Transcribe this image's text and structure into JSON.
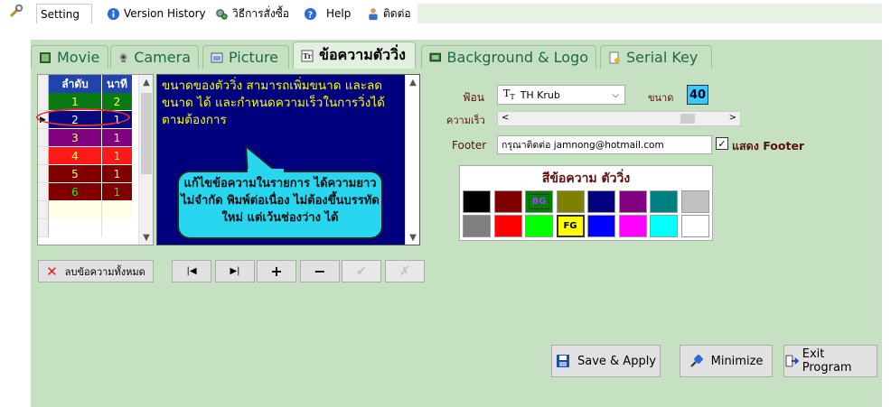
{
  "menu": {
    "items": [
      {
        "label": "Setting"
      },
      {
        "label": "Version History"
      },
      {
        "label": "วิธีการสั่งซื้อ"
      },
      {
        "label": "Help"
      },
      {
        "label": "ติดต่อ"
      }
    ]
  },
  "tabs": [
    {
      "label": "Movie"
    },
    {
      "label": "Camera"
    },
    {
      "label": "Picture"
    },
    {
      "label": "ข้อความตัววิ่ง"
    },
    {
      "label": "Background & Logo"
    },
    {
      "label": "Serial Key"
    }
  ],
  "grid": {
    "headers": [
      "ลำดับ",
      "นาที"
    ],
    "rows": [
      {
        "order": "1",
        "minutes": "2",
        "bg": "#0a7a12",
        "fg": "#ffff66"
      },
      {
        "order": "2",
        "minutes": "1",
        "bg": "#0a0a80",
        "fg": "#ffffff"
      },
      {
        "order": "3",
        "minutes": "1",
        "bg": "#800080",
        "fg": "#ffff66"
      },
      {
        "order": "4",
        "minutes": "1",
        "bg": "#ff1a1a",
        "fg": "#ffff66"
      },
      {
        "order": "5",
        "minutes": "1",
        "bg": "#800000",
        "fg": "#ffff66"
      },
      {
        "order": "6",
        "minutes": "1",
        "bg": "#800000",
        "fg": "#00ff00"
      }
    ]
  },
  "text_area": {
    "value": "ขนาดของตัววิ่ง สามารถเพิ่มขนาด และลดขนาด ได้ และกำหนดความเร็วในการวิ่งได้ ตามต้องการ"
  },
  "callout": {
    "text": "แก้ไขข้อความในรายการ ได้ความยาว ไม่จำกัด พิมพ์ต่อเนื่อง ไม่ต้องขึ้นบรรทัดใหม่ แต่เว้นช่องว่าง ได้"
  },
  "buttons": {
    "clear_all": "ลบข้อความทั้งหมด",
    "save_apply": "Save & Apply",
    "minimize": "Minimize",
    "exit": "Exit Program"
  },
  "font_settings": {
    "font_label": "ฟ้อน",
    "font_value": "TH Krub",
    "size_label": "ขนาด",
    "size_value": "40",
    "speed_label": "ความเร็ว",
    "footer_label": "Footer",
    "footer_value": "กรุณาติดต่อ jamnong@hotmail.com",
    "show_footer_label": "แสดง Footer",
    "show_footer_checked": true
  },
  "palette": {
    "title": "สีข้อความ ตัววิ่ง",
    "bg_marker": "BG",
    "fg_marker": "FG",
    "colors": [
      "#000000",
      "#800000",
      "#008000",
      "#808000",
      "#000080",
      "#800080",
      "#008080",
      "#c0c0c0",
      "#808080",
      "#ff0000",
      "#00ff00",
      "#ffff00",
      "#0000ff",
      "#ff00ff",
      "#00ffff",
      "#ffffff"
    ]
  }
}
